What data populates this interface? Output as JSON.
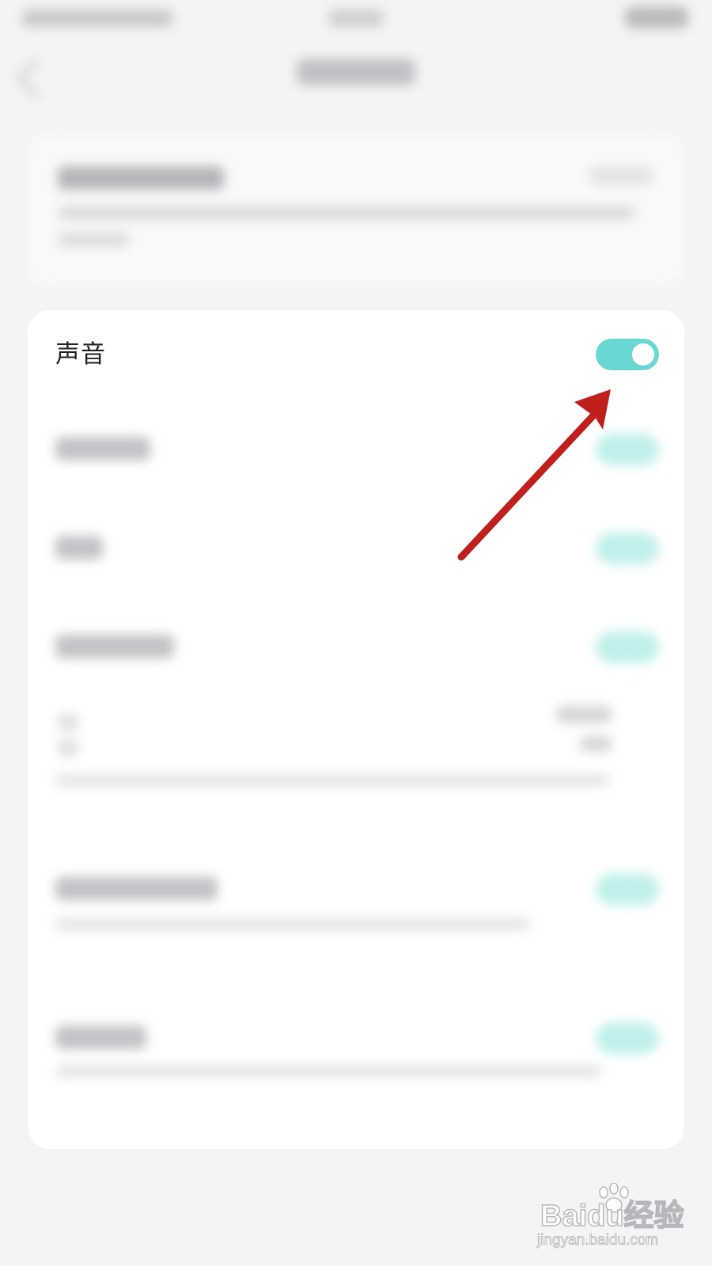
{
  "sound_setting": {
    "label": "声音",
    "enabled": true,
    "toggle_color": "#6ad8d2"
  },
  "annotation": {
    "arrow_color": "#c0201c"
  },
  "watermark": {
    "brand": "Baidu经验",
    "url": "jingyan.baidu.com"
  }
}
